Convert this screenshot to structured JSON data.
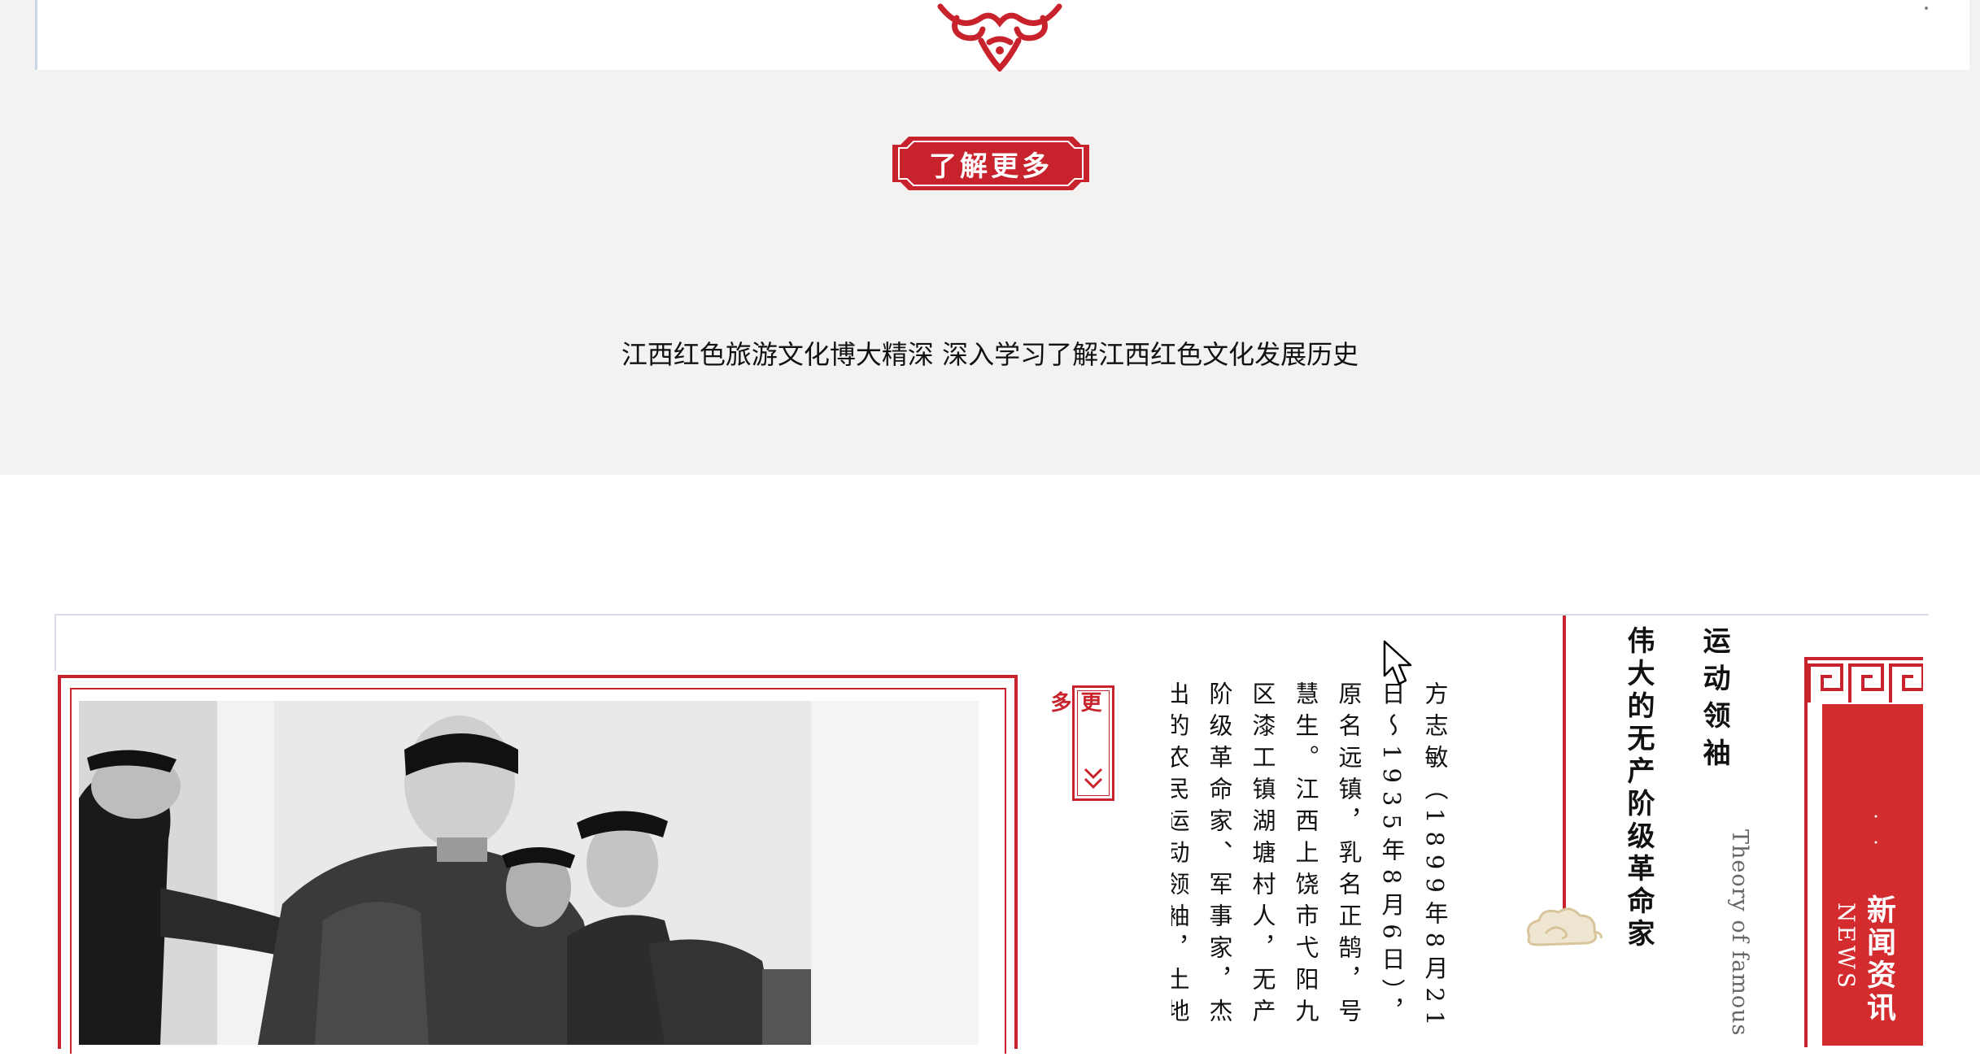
{
  "learn_more": {
    "label": "了解更多"
  },
  "tagline": "江西红色旅游文化博大精深 深入学习了解江西红色文化发展历史",
  "more_badge": {
    "label": "更 多"
  },
  "article": {
    "body": "方志敏（1899年8月21日～1935年8月6日），原名远镇，乳名正鹄，号慧生。江西上饶市弋阳九区漆工镇湖塘村人，无产阶级革命家、军事家，杰出的农民运动领袖，土地革命战争时期赣东北和闽浙赣革命根据地的创建人。",
    "headline": "伟大的无产阶级革命家",
    "subhead": "运动领袖",
    "theory": "Theory of famous people"
  },
  "news": {
    "cn": "新闻资讯",
    "en": "NEWS",
    "dot": "。"
  },
  "colors": {
    "brand_red": "#c8232c",
    "band_bg": "#f4f1f1",
    "banner_red": "#d42b2f"
  },
  "icons": [
    "ornament-cloud-icon",
    "chevron-double-down-icon",
    "auspicious-cloud-icon",
    "mouse-cursor-icon"
  ]
}
